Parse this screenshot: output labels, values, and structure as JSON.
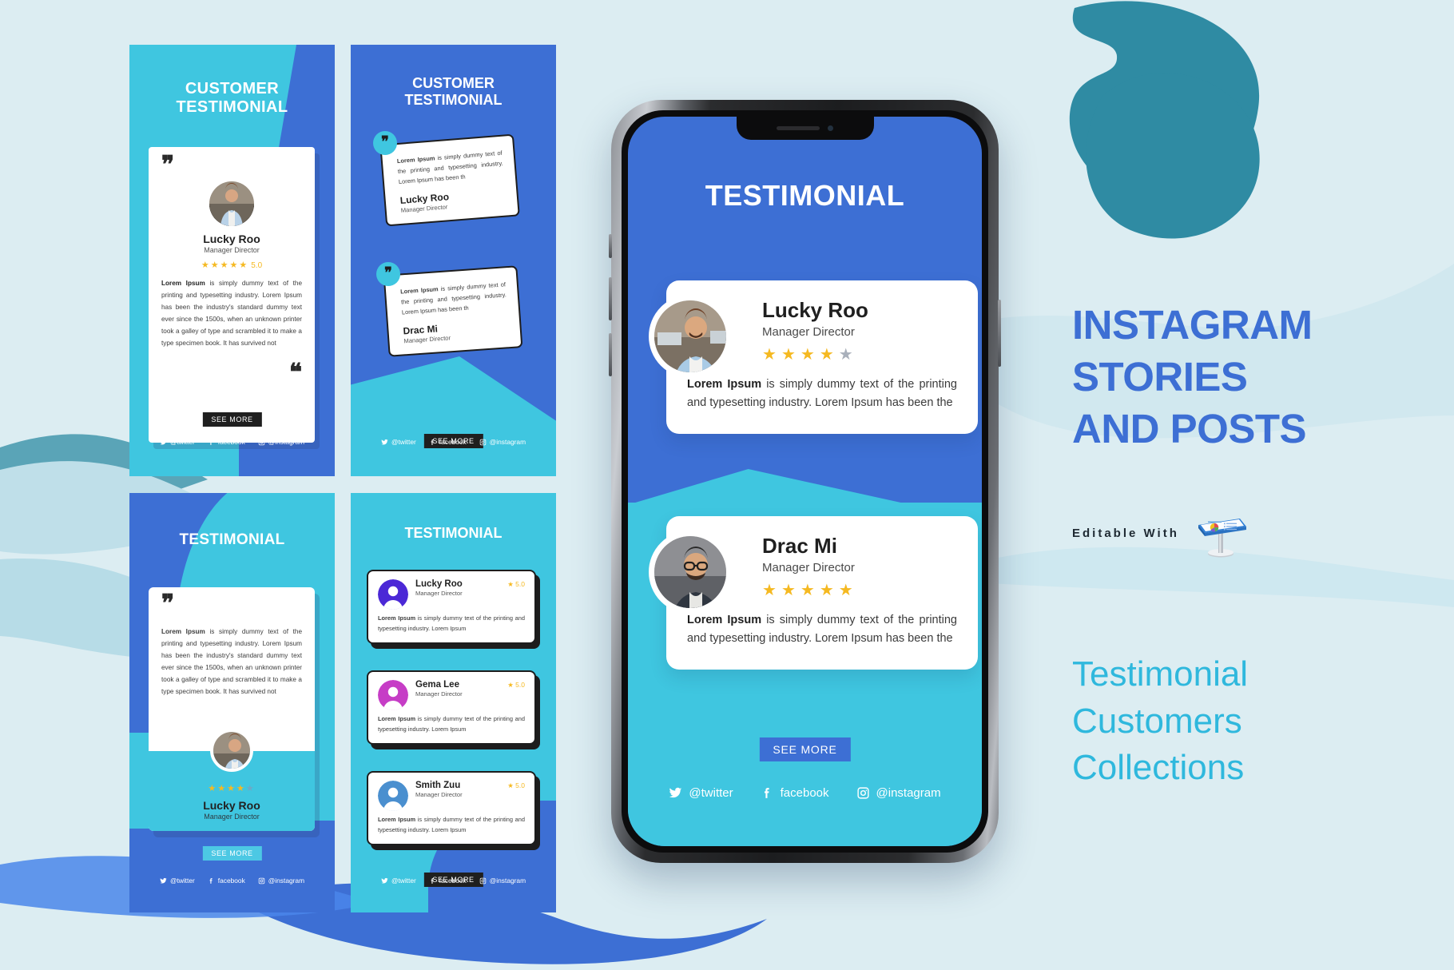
{
  "colors": {
    "bg": "#dcedf2",
    "cyan": "#3fc6e0",
    "blue": "#3d6fd4",
    "dark": "#1f1f1f",
    "star": "#f5b921",
    "teal_blob": "#2f8ba3",
    "heading_blue": "#3d6fd4",
    "sub_cyan": "#2fb8dd"
  },
  "lorem": {
    "long": "Lorem Ipsum is simply dummy text of the printing and typesetting industry. Lorem Ipsum has been the industry's standard dummy text ever since the 1500s, when an unknown printer took a galley of type and scrambled it to make a type specimen book. It has survived not",
    "short": "Lorem Ipsum is simply dummy text of the printing and typesetting industry. Lorem Ipsum has been th",
    "medium": "Lorem Ipsum is simply dummy text of the printing and typesetting industry. Lorem Ipsum has been the",
    "tiny": "Lorem Ipsum is simply dummy text of the printing and typesetting industry. Lorem Ipsum",
    "bold_lead": "Lorem Ipsum"
  },
  "panel1": {
    "title_line1": "CUSTOMER",
    "title_line2": "TESTIMONIAL",
    "name": "Lucky Roo",
    "role": "Manager Director",
    "rating": "5.0",
    "stars": 5,
    "see_more": "SEE MORE"
  },
  "panel2": {
    "title_line1": "CUSTOMER",
    "title_line2": "TESTIMONIAL",
    "cards": [
      {
        "name": "Lucky Roo",
        "role": "Manager Director"
      },
      {
        "name": "Drac Mi",
        "role": "Manager Director"
      }
    ],
    "see_more": "SEE MORE"
  },
  "panel3": {
    "title": "TESTIMONIAL",
    "name": "Lucky Roo",
    "role": "Manager Director",
    "stars_filled": 4,
    "stars_total": 5,
    "see_more": "SEE MORE"
  },
  "panel4": {
    "title": "TESTIMONIAL",
    "see_more": "SEE MORE",
    "cards": [
      {
        "name": "Lucky Roo",
        "role": "Manager Director",
        "rating": "5.0",
        "avatar_color": "#4b28d6"
      },
      {
        "name": "Gema Lee",
        "role": "Manager Director",
        "rating": "5.0",
        "avatar_color": "#c63dc6"
      },
      {
        "name": "Smith Zuu",
        "role": "Manager Director",
        "rating": "5.0",
        "avatar_color": "#4a8fcf"
      }
    ]
  },
  "phone": {
    "title": "TESTIMONIAL",
    "see_more": "SEE MORE",
    "cards": [
      {
        "name": "Lucky Roo",
        "role": "Manager Director",
        "stars_filled": 4,
        "stars_total": 5
      },
      {
        "name": "Drac Mi",
        "role": "Manager Director",
        "stars_filled": 5,
        "stars_total": 5
      }
    ]
  },
  "socials": {
    "twitter": "@twitter",
    "facebook": "facebook",
    "instagram": "@instagram"
  },
  "right": {
    "headline_l1": "INSTAGRAM",
    "headline_l2": "STORIES",
    "headline_l3": "AND POSTS",
    "editable_label": "Editable With",
    "editable_app": "keynote-icon",
    "sub_l1": "Testimonial",
    "sub_l2": "Customers",
    "sub_l3": "Collections"
  }
}
